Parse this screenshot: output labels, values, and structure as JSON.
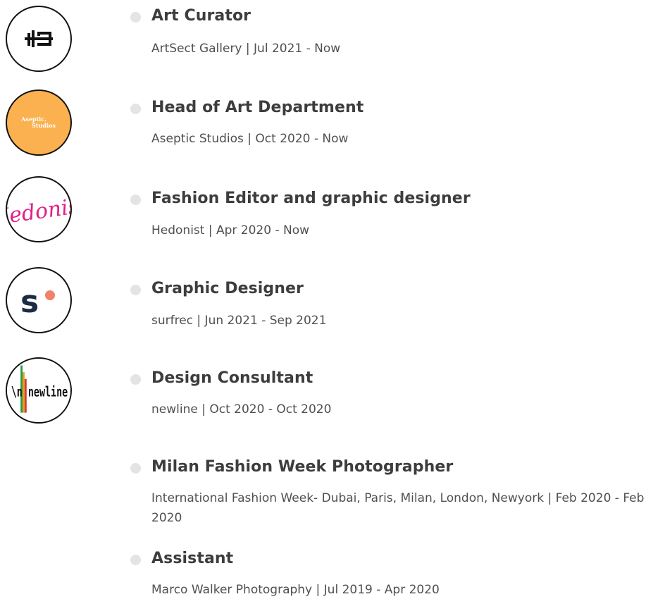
{
  "experience": [
    {
      "logo_icon": "artsect-logo-icon",
      "title": "Art Curator",
      "subtitle": "ArtSect Gallery | Jul 2021 - Now"
    },
    {
      "logo_icon": "aseptic-studios-logo-icon",
      "logo_text_line1": "Aseptic.",
      "logo_text_line2": "Studios",
      "title": "Head of Art Department",
      "subtitle": "Aseptic Studios | Oct 2020 - Now"
    },
    {
      "logo_icon": "hedonist-logo-icon",
      "logo_text": "Hedonist",
      "title": "Fashion Editor and graphic designer",
      "subtitle": "Hedonist | Apr 2020 - Now"
    },
    {
      "logo_icon": "surfrec-logo-icon",
      "title": "Graphic Designer",
      "subtitle": "surfrec | Jun 2021 - Sep 2021"
    },
    {
      "logo_icon": "newline-logo-icon",
      "logo_text": "\\n newline",
      "title": "Design Consultant",
      "subtitle": "newline | Oct 2020 - Oct 2020"
    },
    {
      "title": "Milan Fashion Week Photographer",
      "subtitle": "International Fashion Week- Dubai, Paris, Milan, London, Newyork | Feb 2020 - Feb 2020"
    },
    {
      "title": "Assistant",
      "subtitle": "Marco Walker Photography | Jul 2019 - Apr 2020"
    }
  ],
  "colors": {
    "bullet": "#e4e4e4",
    "aseptic_bg": "#fbb14f",
    "hedonist_pink": "#e0218a",
    "surfrec_navy": "#1d2b45",
    "surfrec_dot": "#f0826a"
  }
}
